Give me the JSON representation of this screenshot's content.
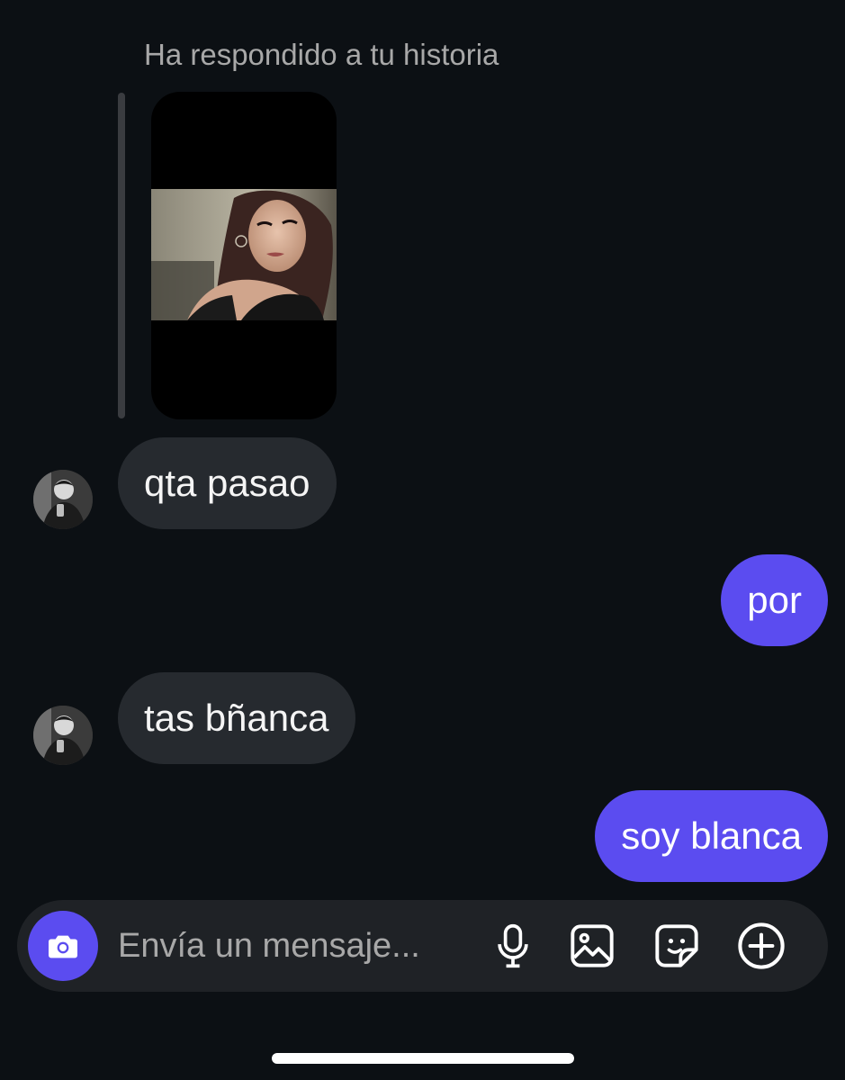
{
  "story_reply": {
    "label": "Ha respondido a tu historia"
  },
  "messages": [
    {
      "direction": "incoming",
      "text": "qta pasao"
    },
    {
      "direction": "outgoing",
      "text": "por"
    },
    {
      "direction": "incoming",
      "text": "tas bñanca"
    },
    {
      "direction": "outgoing",
      "text": "soy blanca"
    }
  ],
  "composer": {
    "placeholder": "Envía un mensaje...",
    "camera_icon": "camera-icon",
    "tools": [
      "microphone-icon",
      "gallery-icon",
      "sticker-icon",
      "plus-circle-icon"
    ]
  },
  "colors": {
    "background": "#0c1014",
    "incoming_bubble": "#262a2f",
    "outgoing_bubble": "#5b4cf0",
    "accent": "#5b4cf0"
  }
}
